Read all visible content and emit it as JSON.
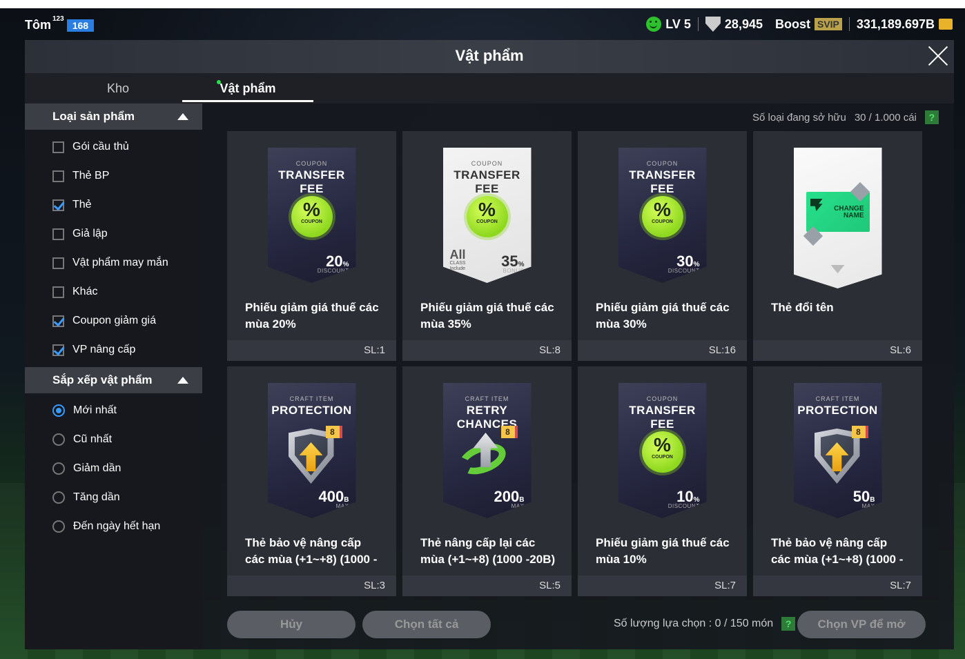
{
  "topbar": {
    "username": "Tôm",
    "user_sup": "123",
    "user_level": "168",
    "lv": "LV 5",
    "points": "28,945",
    "boost": "Boost",
    "svip": "SVIP",
    "coins": "331,189.697B"
  },
  "panel": {
    "title": "Vật phẩm"
  },
  "tabs": [
    {
      "label": "Kho",
      "active": false
    },
    {
      "label": "Vật phẩm",
      "active": true
    }
  ],
  "filters": {
    "type_header": "Loại sản phẩm",
    "types": [
      {
        "label": "Gói cầu thủ",
        "checked": false
      },
      {
        "label": "Thẻ BP",
        "checked": false
      },
      {
        "label": "Thẻ",
        "checked": true
      },
      {
        "label": "Giả lập",
        "checked": false
      },
      {
        "label": "Vật phẩm may mắn",
        "checked": false
      },
      {
        "label": "Khác",
        "checked": false
      },
      {
        "label": "Coupon giảm giá",
        "checked": true
      },
      {
        "label": "VP nâng cấp",
        "checked": true
      }
    ],
    "sort_header": "Sắp xếp vật phẩm",
    "sorts": [
      {
        "label": "Mới nhất",
        "selected": true
      },
      {
        "label": "Cũ nhất",
        "selected": false
      },
      {
        "label": "Giảm dần",
        "selected": false
      },
      {
        "label": "Tăng dần",
        "selected": false
      },
      {
        "label": "Đến ngày hết hạn",
        "selected": false
      }
    ]
  },
  "owned": {
    "label": "Số loại đang sở hữu",
    "value": "30 / 1.000 cái",
    "help": "?"
  },
  "items": [
    {
      "name": "Phiếu giảm giá thuế các mùa 20%",
      "qty": "SL:1",
      "kind": "coupon",
      "small": "COUPON",
      "big": "TRANSFER FEE",
      "value": "20",
      "unit": "%",
      "sub": "DISCOUNT"
    },
    {
      "name": "Phiếu giảm giá thuế các mùa 35%",
      "qty": "SL:8",
      "kind": "coupon-white",
      "small": "COUPON",
      "big": "TRANSFER FEE",
      "value": "35",
      "unit": "%",
      "sub": "BONUS",
      "all": "All",
      "all_sub1": "CLASS",
      "all_sub2": "Include"
    },
    {
      "name": "Phiếu giảm giá thuế các mùa 30%",
      "qty": "SL:16",
      "kind": "coupon",
      "small": "COUPON",
      "big": "TRANSFER FEE",
      "value": "30",
      "unit": "%",
      "sub": "DISCOUNT"
    },
    {
      "name": "Thẻ đổi tên",
      "qty": "SL:6",
      "kind": "rename",
      "rename_l1": "CHANGE",
      "rename_l2": "NAME"
    },
    {
      "name": "Thẻ bảo vệ nâng cấp các mùa (+1~+8) (1000 -",
      "qty": "SL:3",
      "kind": "protect",
      "small": "CRAFT ITEM",
      "big": "PROTECTION",
      "value": "400",
      "unit": "B",
      "sub": "MAX",
      "badge": "8"
    },
    {
      "name": "Thẻ nâng cấp lại các mùa (+1~+8) (1000 -20B)",
      "qty": "SL:5",
      "kind": "retry",
      "small": "CRAFT ITEM",
      "big": "RETRY CHANCES",
      "value": "200",
      "unit": "B",
      "sub": "MAX",
      "badge": "8"
    },
    {
      "name": "Phiếu giảm giá thuế các mùa 10%",
      "qty": "SL:7",
      "kind": "coupon",
      "small": "COUPON",
      "big": "TRANSFER FEE",
      "value": "10",
      "unit": "%",
      "sub": "DISCOUNT"
    },
    {
      "name": "Thẻ bảo vệ nâng cấp các mùa (+1~+8) (1000 -",
      "qty": "SL:7",
      "kind": "protect",
      "small": "CRAFT ITEM",
      "big": "PROTECTION",
      "value": "50",
      "unit": "B",
      "sub": "MAX",
      "badge": "8"
    }
  ],
  "coupon_badge": {
    "symbol": "%",
    "label": "COUPON"
  },
  "bottom": {
    "cancel": "Hủy",
    "select_all": "Chọn tất cả",
    "select_count_label": "Số lượng lựa chọn : 0 / 150 món",
    "help": "?",
    "open": "Chọn VP để mở"
  }
}
